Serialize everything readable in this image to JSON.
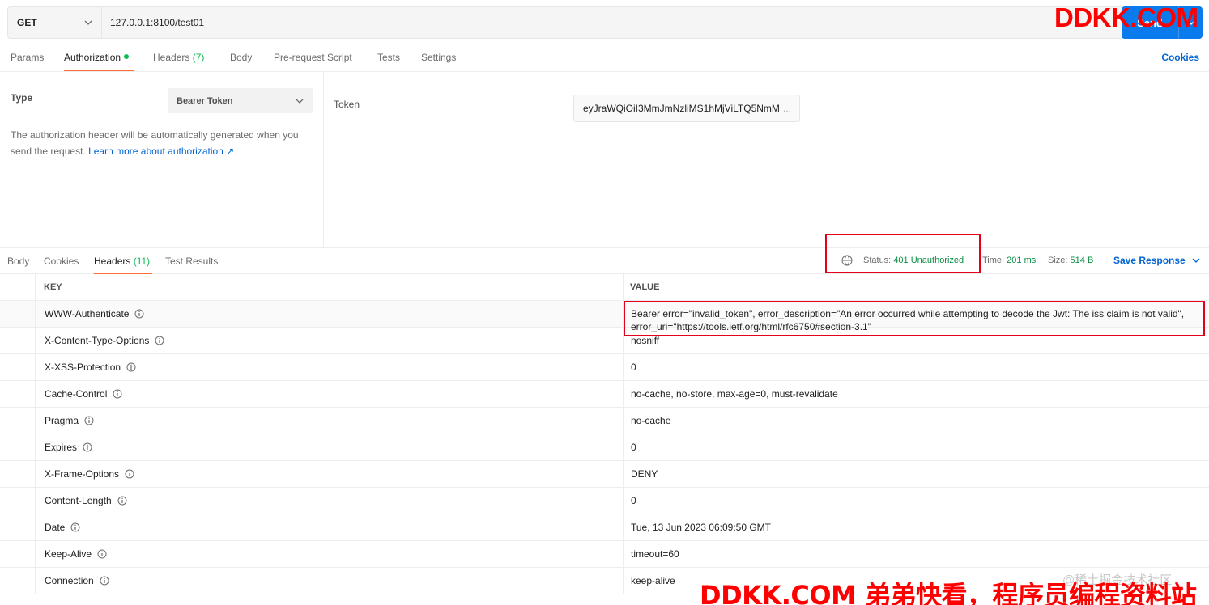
{
  "request": {
    "method": "GET",
    "url": "127.0.0.1:8100/test01",
    "send_label": "Send"
  },
  "watermark": {
    "top": "DDKK.COM",
    "bottom": "DDKK.COM 弟弟快看，程序员编程资料站",
    "juejin": "@稀土掘金技术社区"
  },
  "request_tabs": [
    {
      "label": "Params"
    },
    {
      "label": "Authorization",
      "active": true,
      "has_dot": true
    },
    {
      "label": "Headers",
      "count": "(7)"
    },
    {
      "label": "Body"
    },
    {
      "label": "Pre-request Script"
    },
    {
      "label": "Tests"
    },
    {
      "label": "Settings"
    }
  ],
  "cookies_link": "Cookies",
  "auth": {
    "type_label": "Type",
    "type_value": "Bearer Token",
    "description": "The authorization header will be automatically generated when you send the request.",
    "learn_more": "Learn more about authorization ↗",
    "token_label": "Token",
    "token_value": "eyJraWQiOiI3MmJmNzliMS1hMjViLTQ5NmM",
    "token_ellipsis": "..."
  },
  "response_tabs": [
    {
      "label": "Body"
    },
    {
      "label": "Cookies"
    },
    {
      "label": "Headers",
      "count": "(11)",
      "active": true
    },
    {
      "label": "Test Results"
    }
  ],
  "response_meta": {
    "status_label": "Status:",
    "status_value": "401 Unauthorized",
    "time_label": "Time:",
    "time_value": "201 ms",
    "size_label": "Size:",
    "size_value": "514 B",
    "save_label": "Save Response"
  },
  "headers_table": {
    "col_key": "KEY",
    "col_value": "VALUE",
    "rows": [
      {
        "key": "WWW-Authenticate",
        "value": "Bearer error=\"invalid_token\", error_description=\"An error occurred while attempting to decode the Jwt: The iss claim is not valid\", error_uri=\"https://tools.ietf.org/html/rfc6750#section-3.1\""
      },
      {
        "key": "X-Content-Type-Options",
        "value": "nosniff"
      },
      {
        "key": "X-XSS-Protection",
        "value": "0"
      },
      {
        "key": "Cache-Control",
        "value": "no-cache, no-store, max-age=0, must-revalidate"
      },
      {
        "key": "Pragma",
        "value": "no-cache"
      },
      {
        "key": "Expires",
        "value": "0"
      },
      {
        "key": "X-Frame-Options",
        "value": "DENY"
      },
      {
        "key": "Content-Length",
        "value": "0"
      },
      {
        "key": "Date",
        "value": "Tue, 13 Jun 2023 06:09:50 GMT"
      },
      {
        "key": "Keep-Alive",
        "value": "timeout=60"
      },
      {
        "key": "Connection",
        "value": "keep-alive"
      }
    ]
  },
  "colors": {
    "accent_orange": "#ff6c37",
    "link_blue": "#0265d2",
    "send_blue": "#097bed",
    "success_green": "#0a8e42",
    "highlight_red": "#e3001b"
  }
}
